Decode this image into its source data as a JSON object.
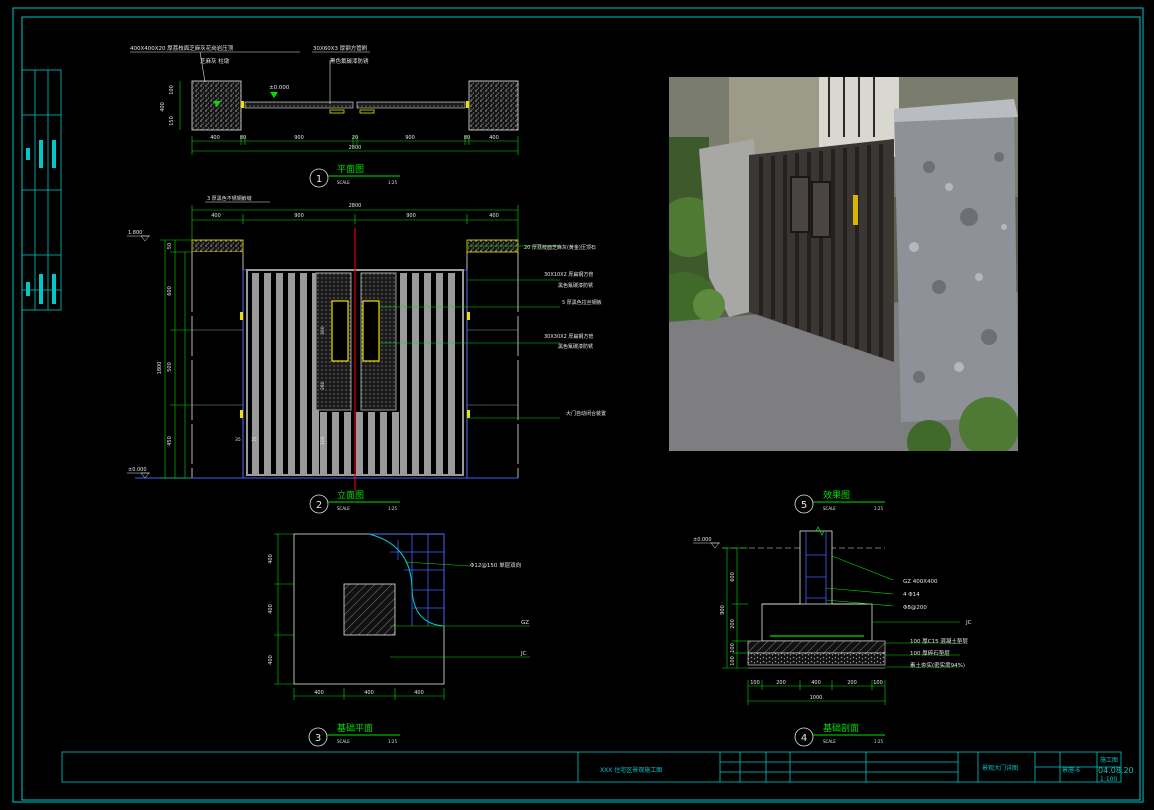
{
  "colors": {
    "frame": "#00c8c8",
    "line_green": "#00e000",
    "line_white": "#e6e6e6",
    "line_yellow": "#f0e000",
    "line_red": "#e00000",
    "line_blue": "#4060ff",
    "line_gray": "#9a9a9a"
  },
  "views": {
    "v1": {
      "num": "1",
      "title": "平面图",
      "scale_label": "SCALE",
      "scale": "1:25"
    },
    "v2": {
      "num": "2",
      "title": "立面图",
      "scale_label": "SCALE",
      "scale": "1:25"
    },
    "v3": {
      "num": "3",
      "title": "基础平面",
      "scale_label": "SCALE",
      "scale": "1:25"
    },
    "v4": {
      "num": "4",
      "title": "基础剖面",
      "scale_label": "SCALE",
      "scale": "1:25"
    },
    "v5": {
      "num": "5",
      "title": "效果图",
      "scale_label": "SCALE",
      "scale": "1:25"
    }
  },
  "plan": {
    "dims": [
      "400",
      "80",
      "900",
      "20",
      "900",
      "80",
      "400"
    ],
    "total": "2800",
    "left_dims": [
      "100",
      "400",
      "150"
    ],
    "callout_left": "400X400X20 厚荔枝面芝麻灰花岗岩压顶",
    "callout_left2": "芝麻灰 柱墩",
    "callout_right": "30X60X3 厚钢方管刷",
    "callout_right2": "黑色氟碳漆防锈",
    "level": "±0.000"
  },
  "elevation": {
    "top_dims": [
      "400",
      "900",
      "900",
      "400"
    ],
    "top_total": "2800",
    "top_note": "3 厚黑色不锈钢嵌缝",
    "left_level_top": "1.800",
    "left_level_bottom": "±0.000",
    "left_dims": [
      "50",
      "600",
      "500",
      "450"
    ],
    "left_total": "1800",
    "notes": [
      "20 厚荔枝面芝麻灰(黄金)压顶石",
      "30X10X2 厚扁钢方管",
      "黑色氟碳漆防锈",
      "5 厚黑色拉丝钢板",
      "30X30X2 厚扁钢方管",
      "黑色氟碳漆防锈",
      "大门自动闭合装置"
    ],
    "inner_dims": [
      "300",
      "280",
      "35",
      "35",
      "100"
    ]
  },
  "foundation_plan": {
    "left_dims": [
      "400",
      "400",
      "400"
    ],
    "bottom_dims": [
      "400",
      "400",
      "400"
    ],
    "labels": [
      "Φ12@150 单层双向",
      "GZ",
      "JC"
    ]
  },
  "foundation_section": {
    "level": "±0.000",
    "left_dims": [
      "600",
      "200",
      "100",
      "100"
    ],
    "left_total": "900",
    "notes": [
      "GZ 400X400",
      "4 Φ14",
      "Φ8@200",
      "JC",
      "100 厚C15 混凝土垫层",
      "100 厚碎石垫层",
      "素土夯实(密实度94%)"
    ],
    "bottom_dims": [
      "100",
      "200",
      "400",
      "200",
      "100"
    ],
    "bottom_total": "1000"
  },
  "titleblock": {
    "project": "XXX 住宅区景观施工图",
    "drawing_name": "景观大门详图",
    "stage": "施工图",
    "date": "04.08.20",
    "scale": "1:100",
    "drawing_no": "景施-6"
  },
  "photo": {
    "alt": "效果图"
  }
}
